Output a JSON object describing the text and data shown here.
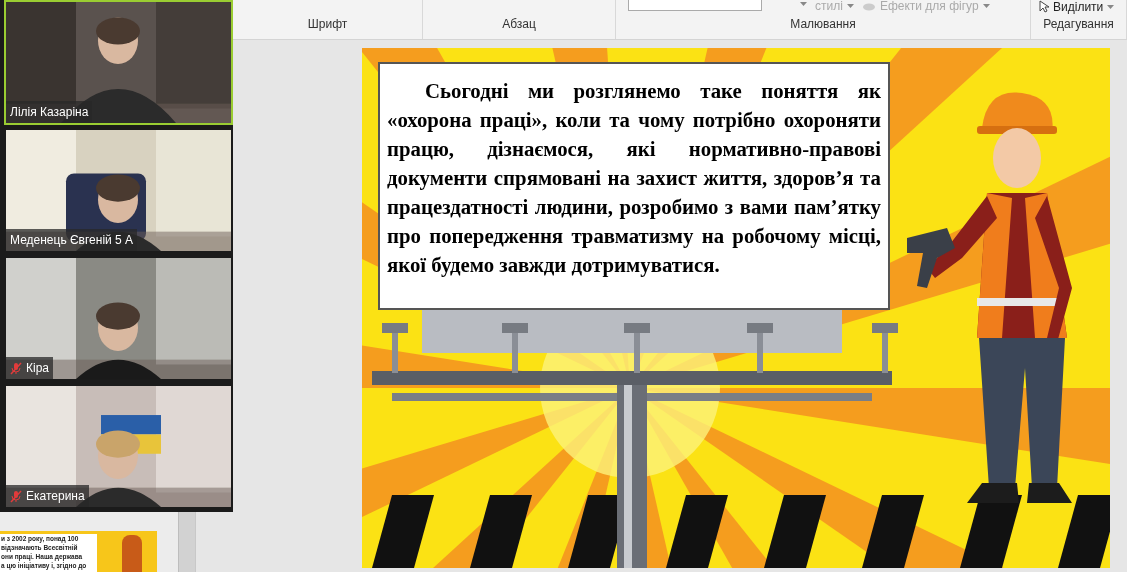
{
  "ribbon": {
    "items": [
      {
        "label": "стилі",
        "kind": "dropdown"
      },
      {
        "label": "Ефекти для фігур",
        "kind": "effects"
      },
      {
        "label": "Виділити",
        "kind": "select"
      }
    ],
    "groups": [
      "Шрифт",
      "Абзац",
      "Малювання",
      "Редагування"
    ]
  },
  "participants": [
    {
      "name": "Лілія Казаріна",
      "speaking": true,
      "muted": false
    },
    {
      "name": "Меденець Євгеній 5 А",
      "speaking": false,
      "muted": false
    },
    {
      "name": "Кіра",
      "speaking": false,
      "muted": true
    },
    {
      "name": "Екатерина",
      "speaking": false,
      "muted": true
    }
  ],
  "thumbnail": {
    "lines": [
      "и з 2002 року, понад 100",
      "відзначають Всесвітній",
      "они праці. Наша держава",
      "а цю ініціативу і, згідно до"
    ]
  },
  "slide": {
    "text": "Сьогодні ми розглянемо таке поняття як «охорона праці», коли та чому потрібно охороняти працю, дізнаємося, які нормативно-правові документи спрямовані на захист життя, здоров’я та працездатності людини, розробимо з вами пам’ятку про попередження травматизму на робочому місці, якої будемо завжди дотримуватися."
  }
}
